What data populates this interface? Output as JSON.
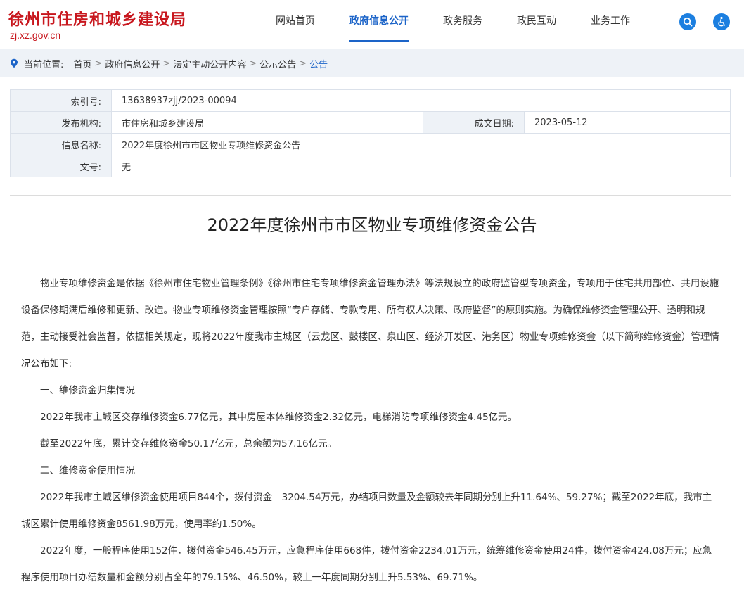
{
  "header": {
    "site_title": "徐州市住房和城乡建设局",
    "site_domain": "zj.xz.gov.cn",
    "nav": [
      {
        "label": "网站首页"
      },
      {
        "label": "政府信息公开"
      },
      {
        "label": "政务服务"
      },
      {
        "label": "政民互动"
      },
      {
        "label": "业务工作"
      }
    ],
    "active_nav_index": 1,
    "icons": [
      "search-icon",
      "accessibility-icon"
    ],
    "accent_color": "#1c64c8",
    "brand_color": "#c8171e"
  },
  "breadcrumb": {
    "prefix": "当前位置:",
    "items": [
      "首页",
      "政府信息公开",
      "法定主动公开内容",
      "公示公告",
      "公告"
    ],
    "separator": ">"
  },
  "info": {
    "index_label": "索引号:",
    "index_value": "13638937zjj/2023-00094",
    "publisher_label": "发布机构:",
    "publisher_value": "市住房和城乡建设局",
    "date_label": "成文日期:",
    "date_value": "2023-05-12",
    "name_label": "信息名称:",
    "name_value": "2022年度徐州市市区物业专项维修资金公告",
    "docno_label": "文号:",
    "docno_value": "无"
  },
  "article": {
    "title": "2022年度徐州市市区物业专项维修资金公告",
    "paragraphs": [
      "物业专项维修资金是依据《徐州市住宅物业管理条例》《徐州市住宅专项维修资金管理办法》等法规设立的政府监管型专项资金，专项用于住宅共用部位、共用设施设备保修期满后维修和更新、改造。物业专项维修资金管理按照“专户存储、专款专用、所有权人决策、政府监督”的原则实施。为确保维修资金管理公开、透明和规范，主动接受社会监督，依据相关规定，现将2022年度我市主城区（云龙区、鼓楼区、泉山区、经济开发区、港务区）物业专项维修资金（以下简称维修资金）管理情况公布如下:",
      "一、维修资金归集情况",
      "2022年我市主城区交存维修资金6.77亿元，其中房屋本体维修资金2.32亿元，电梯消防专项维修资金4.45亿元。",
      "截至2022年底，累计交存维修资金50.17亿元，总余额为57.16亿元。",
      "二、维修资金使用情况",
      "2022年我市主城区维修资金使用项目844个，拨付资金　3204.54万元，办结项目数量及金额较去年同期分别上升11.64%、59.27%；截至2022年底，我市主城区累计使用维修资金8561.98万元，使用率约1.50%。",
      "2022年度，一般程序使用152件，拨付资金546.45万元，应急程序使用668件，拨付资金2234.01万元，统筹维修资金使用24件，拨付资金424.08万元；应急程序使用项目办结数量和金额分别占全年的79.15%、46.50%，较上一年度同期分别上升5.53%、69.71%。"
    ]
  }
}
